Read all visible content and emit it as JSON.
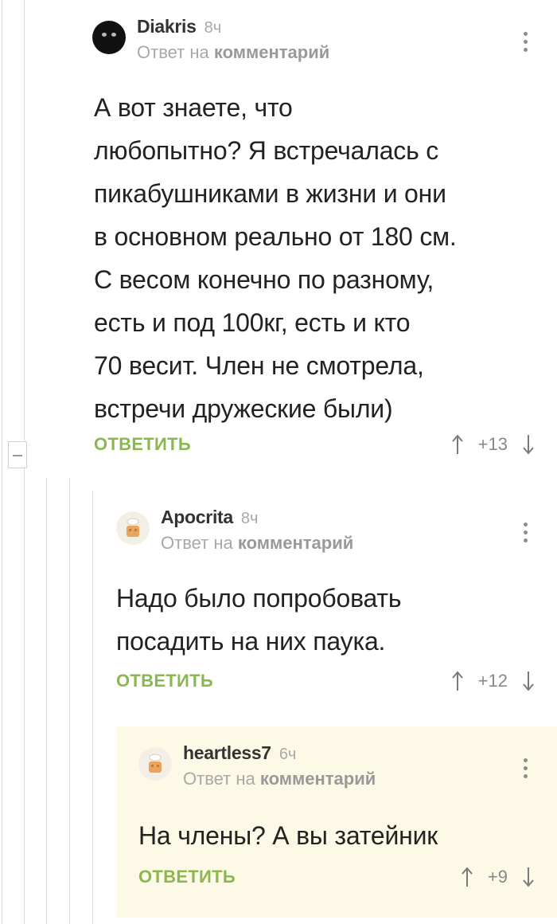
{
  "comments": [
    {
      "username": "Diakris",
      "time": "8ч",
      "reply_prefix": "Ответ на",
      "reply_target": "комментарий",
      "text": "А вот знаете, что\nлюбопытно? Я встречалась с\nпикабушниками в жизни и они\nв основном реально от 180 см.\nС весом конечно по разному,\nесть и под 100кг, есть и кто\n70 весит. Член не смотрела,\nвстречи дружеские были)",
      "reply_label": "ОТВЕТИТЬ",
      "rating": "+13",
      "avatar": "black-cat-avatar"
    },
    {
      "username": "Apocrita",
      "time": "8ч",
      "reply_prefix": "Ответ на",
      "reply_target": "комментарий",
      "text": "Надо было попробовать\nпосадить на них паука.",
      "reply_label": "ОТВЕТИТЬ",
      "rating": "+12",
      "avatar": "default-pikabu-avatar"
    },
    {
      "username": "heartless7",
      "time": "6ч",
      "reply_prefix": "Ответ на",
      "reply_target": "комментарий",
      "text": "На члены? А вы затейник",
      "reply_label": "ОТВЕТИТЬ",
      "rating": "+9",
      "avatar": "default-pikabu-avatar"
    }
  ],
  "colors": {
    "accent_green": "#8ab84e",
    "highlight_bg": "#fdf9e7",
    "thread_line": "#dcdcdc"
  },
  "icons": [
    "collapse-thread-icon",
    "more-options-icon",
    "upvote-arrow-icon",
    "downvote-arrow-icon"
  ]
}
